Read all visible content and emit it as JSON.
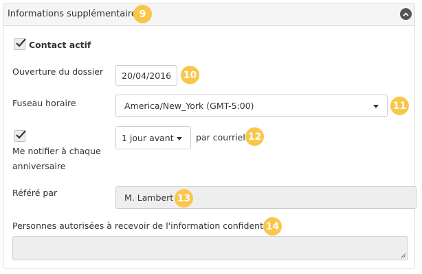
{
  "panel": {
    "title": "Informations supplémentaires"
  },
  "badges": {
    "b9": "9",
    "b10": "10",
    "b11": "11",
    "b12": "12",
    "b13": "13",
    "b14": "14"
  },
  "contact_active": {
    "label": "Contact actif",
    "checked": true
  },
  "opening_date": {
    "label": "Ouverture du dossier",
    "value": "20/04/2016"
  },
  "timezone": {
    "label": "Fuseau horaire",
    "value": "America/New_York (GMT-5:00)"
  },
  "anniversary_notify": {
    "label_line1": "Me notifier à chaque",
    "label_line2": "anniversaire",
    "checked": true,
    "timing_value": "1 jour avant",
    "suffix": "par courriel"
  },
  "referred_by": {
    "label": "Référé par",
    "value": "M. Lambert"
  },
  "authorized_persons": {
    "label": "Personnes autorisées à recevoir de l'information confidentielle",
    "value": ""
  },
  "colors": {
    "badge": "#f9c64a",
    "header_bg": "#f5f5f5",
    "readonly_bg": "#eeeeee"
  }
}
